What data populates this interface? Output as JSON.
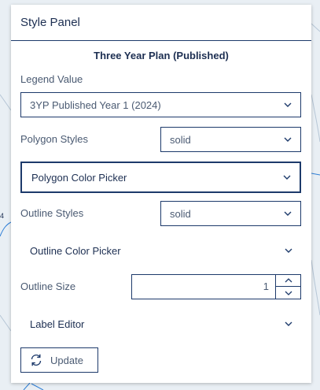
{
  "panel": {
    "title": "Style Panel",
    "section_title": "Three Year Plan (Published)",
    "legend": {
      "label": "Legend Value",
      "value": "3YP Published Year 1 (2024)"
    },
    "polygon_styles": {
      "label": "Polygon Styles",
      "value": "solid"
    },
    "polygon_color_picker": {
      "label": "Polygon Color Picker"
    },
    "outline_styles": {
      "label": "Outline Styles",
      "value": "solid"
    },
    "outline_color_picker": {
      "label": "Outline Color Picker"
    },
    "outline_size": {
      "label": "Outline Size",
      "value": "1"
    },
    "label_editor": {
      "label": "Label Editor"
    },
    "update_button": {
      "label": "Update"
    }
  },
  "map_fragment_text": "4",
  "colors": {
    "accent": "#1d3a6b",
    "text": "#1d2f52",
    "muted_text": "#4a5a72",
    "map_lines": "#2f7fd6"
  }
}
